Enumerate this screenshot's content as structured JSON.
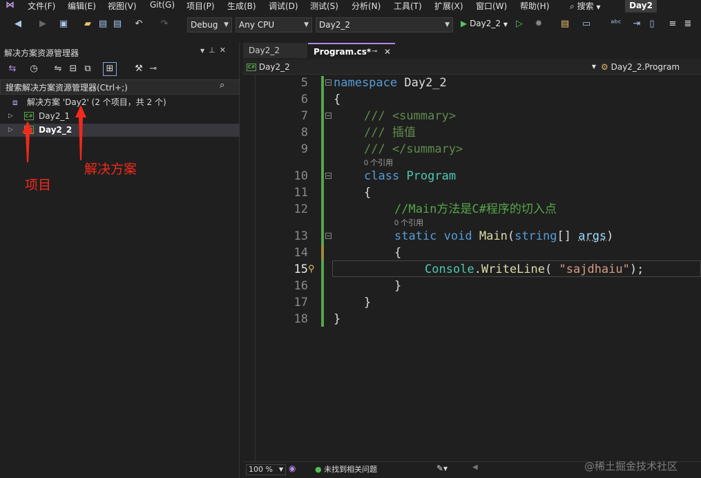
{
  "menu": {
    "items": [
      "文件(F)",
      "编辑(E)",
      "视图(V)",
      "Git(G)",
      "项目(P)",
      "生成(B)",
      "调试(D)",
      "测试(S)",
      "分析(N)",
      "工具(T)",
      "扩展(X)",
      "窗口(W)",
      "帮助(H)"
    ],
    "search": "搜索",
    "solution_name": "Day2"
  },
  "toolbar": {
    "config": "Debug",
    "platform": "Any CPU",
    "startup_project": "Day2_2",
    "start_label": "Day2_2"
  },
  "solution_explorer": {
    "title": "解决方案资源管理器",
    "search_placeholder": "搜索解决方案资源管理器(Ctrl+;)",
    "solution_label": "解决方案 'Day2' (2 个项目，共 2 个)",
    "projects": [
      {
        "name": "Day2_1",
        "icon": "C#"
      },
      {
        "name": "Day2_2",
        "icon": "C#"
      }
    ]
  },
  "annotations": {
    "project": "项目",
    "solution": "解决方案"
  },
  "editor": {
    "tabs": [
      {
        "label": "Day2_2"
      },
      {
        "label": "Program.cs*"
      }
    ],
    "nav_project": "Day2_2",
    "nav_class": "Day2_2.Program",
    "project_icon": "C#",
    "codelens_refs": "0 个引用",
    "line_numbers": [
      "5",
      "6",
      "7",
      "8",
      "9",
      "10",
      "11",
      "12",
      "13",
      "14",
      "15",
      "16",
      "17",
      "18"
    ],
    "code": {
      "l5_kw": "namespace",
      "l5_name": " Day2_2",
      "l6": "{",
      "l7": "/// <summary>",
      "l8": "/// 插值",
      "l9": "/// </summary>",
      "l10_kw": "class",
      "l10_name": "Program",
      "l11": "{",
      "l12": "//Main方法是C#程序的切入点",
      "l13_static": "static",
      "l13_void": "void",
      "l13_main": "Main",
      "l13_open": "(",
      "l13_string": "string",
      "l13_brackets": "[] ",
      "l13_args": "args",
      "l13_close": ")",
      "l14": "{",
      "l15_console": "Console",
      "l15_dot": ".",
      "l15_method": "WriteLine",
      "l15_open": "( ",
      "l15_str": "\"sajdhaiu\"",
      "l15_close": ");",
      "l16": "}",
      "l17": "}",
      "l18": "}"
    }
  },
  "status": {
    "zoom": "100 %",
    "issues": "未找到相关问题"
  },
  "watermark": "@稀土掘金技术社区",
  "colors": {
    "keyword": "#569cd6",
    "type": "#4ec9b0",
    "comment": "#57a64a",
    "string": "#d69d85",
    "annotation": "#f2291c",
    "change_bar": "#57a64a"
  }
}
